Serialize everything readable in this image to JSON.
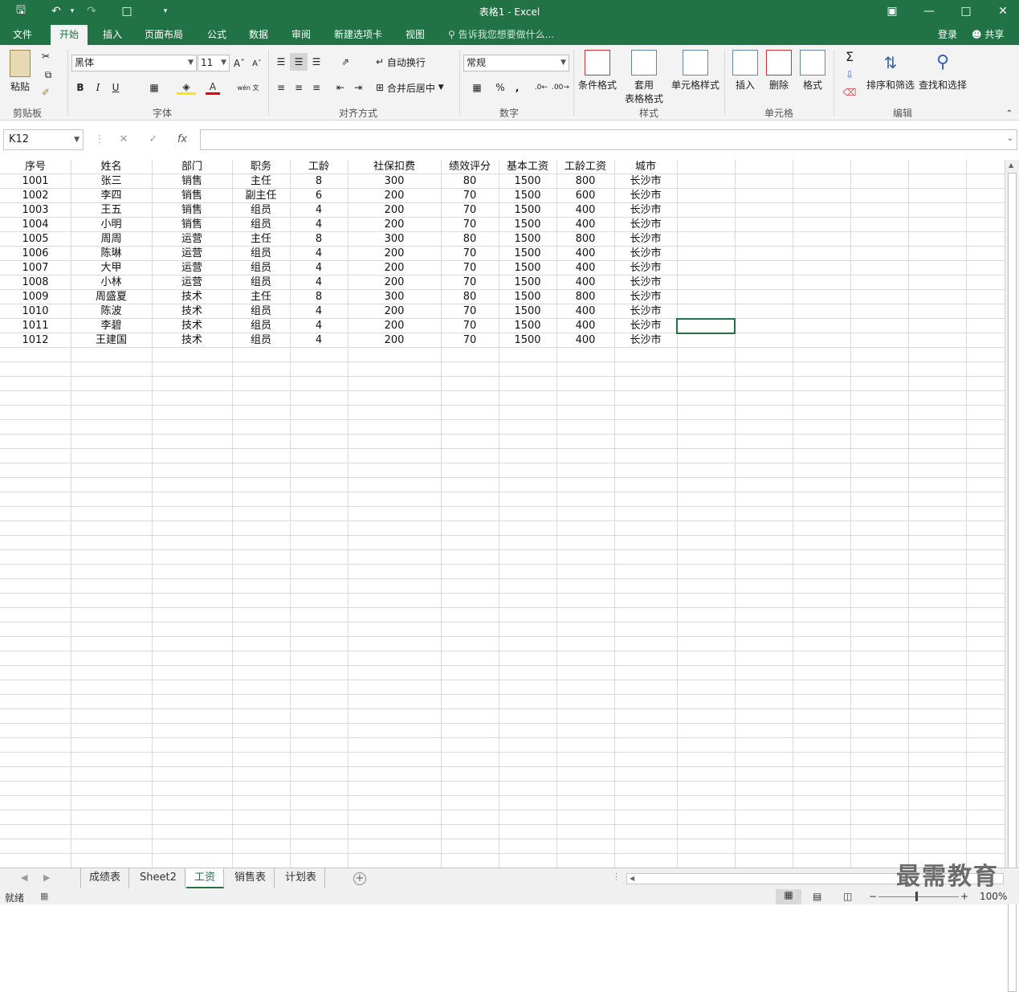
{
  "window": {
    "title": "表格1 - Excel"
  },
  "tabs": [
    "文件",
    "开始",
    "插入",
    "页面布局",
    "公式",
    "数据",
    "审阅",
    "新建选项卡",
    "视图"
  ],
  "active_tab": "开始",
  "tellme": "告诉我您想要做什么...",
  "account": {
    "login": "登录",
    "share": "共享"
  },
  "ribbon": {
    "clipboard": {
      "paste": "粘贴",
      "label": "剪贴板"
    },
    "font": {
      "name": "黑体",
      "size": "11",
      "label": "字体",
      "bold": "B",
      "italic": "I",
      "underline": "U",
      "wen": "wén 文"
    },
    "align": {
      "wrap": "自动换行",
      "merge": "合并后居中",
      "label": "对齐方式"
    },
    "number": {
      "format": "常规",
      "label": "数字",
      "percent": "%",
      "comma": ","
    },
    "styles": {
      "conditional": "条件格式",
      "table_line1": "套用",
      "table_line2": "表格格式",
      "cell_styles": "单元格样式",
      "label": "样式"
    },
    "cells": {
      "insert": "插入",
      "delete": "删除",
      "format": "格式",
      "label": "单元格"
    },
    "editing": {
      "sort": "排序和筛选",
      "find": "查找和选择",
      "label": "编辑"
    }
  },
  "namebox": "K12",
  "columns": [
    "序号",
    "姓名",
    "部门",
    "职务",
    "工龄",
    "社保扣费",
    "绩效评分",
    "基本工资",
    "工龄工资",
    "城市"
  ],
  "rows": [
    [
      "1001",
      "张三",
      "销售",
      "主任",
      "8",
      "300",
      "80",
      "1500",
      "800",
      "长沙市"
    ],
    [
      "1002",
      "李四",
      "销售",
      "副主任",
      "6",
      "200",
      "70",
      "1500",
      "600",
      "长沙市"
    ],
    [
      "1003",
      "王五",
      "销售",
      "组员",
      "4",
      "200",
      "70",
      "1500",
      "400",
      "长沙市"
    ],
    [
      "1004",
      "小明",
      "销售",
      "组员",
      "4",
      "200",
      "70",
      "1500",
      "400",
      "长沙市"
    ],
    [
      "1005",
      "周周",
      "运营",
      "主任",
      "8",
      "300",
      "80",
      "1500",
      "800",
      "长沙市"
    ],
    [
      "1006",
      "陈琳",
      "运营",
      "组员",
      "4",
      "200",
      "70",
      "1500",
      "400",
      "长沙市"
    ],
    [
      "1007",
      "大甲",
      "运营",
      "组员",
      "4",
      "200",
      "70",
      "1500",
      "400",
      "长沙市"
    ],
    [
      "1008",
      "小林",
      "运营",
      "组员",
      "4",
      "200",
      "70",
      "1500",
      "400",
      "长沙市"
    ],
    [
      "1009",
      "周盛夏",
      "技术",
      "主任",
      "8",
      "300",
      "80",
      "1500",
      "800",
      "长沙市"
    ],
    [
      "1010",
      "陈波",
      "技术",
      "组员",
      "4",
      "200",
      "70",
      "1500",
      "400",
      "长沙市"
    ],
    [
      "1011",
      "李碧",
      "技术",
      "组员",
      "4",
      "200",
      "70",
      "1500",
      "400",
      "长沙市"
    ],
    [
      "1012",
      "王建国",
      "技术",
      "组员",
      "4",
      "200",
      "70",
      "1500",
      "400",
      "长沙市"
    ]
  ],
  "sheets": [
    "成绩表",
    "Sheet2",
    "工资",
    "销售表",
    "计划表"
  ],
  "active_sheet": "工资",
  "status": {
    "ready": "就绪",
    "zoom": "100%"
  },
  "watermark": "最需教育",
  "colors": {
    "accent": "#217346",
    "ribbon_bg": "#f3f3f3"
  }
}
